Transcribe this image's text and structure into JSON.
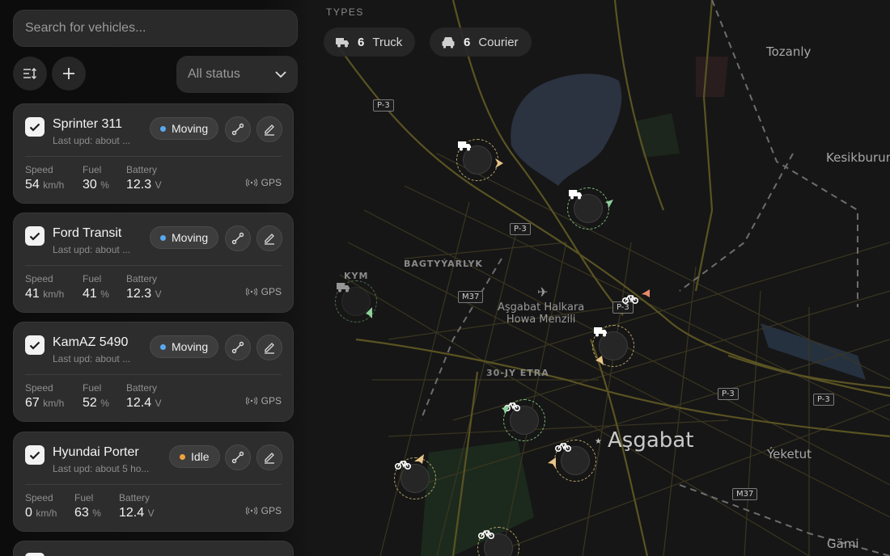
{
  "search": {
    "placeholder": "Search for vehicles..."
  },
  "toolbar": {
    "status_filter": "All status"
  },
  "types": {
    "title": "TYPES",
    "chips": [
      {
        "count": "6",
        "label": "Truck",
        "icon": "truck-icon"
      },
      {
        "count": "6",
        "label": "Courier",
        "icon": "car-icon"
      }
    ]
  },
  "metric_labels": {
    "speed": "Speed",
    "fuel": "Fuel",
    "battery": "Battery"
  },
  "units": {
    "speed": "km/h",
    "fuel": "%",
    "battery": "V"
  },
  "gps_label": "GPS",
  "vehicles": [
    {
      "name": "Sprinter 311",
      "updated": "Last upd: about ...",
      "status": "Moving",
      "status_color": "#5aa9f0",
      "speed": "54",
      "fuel": "30",
      "battery": "12.3"
    },
    {
      "name": "Ford Transit",
      "updated": "Last upd: about ...",
      "status": "Moving",
      "status_color": "#5aa9f0",
      "speed": "41",
      "fuel": "41",
      "battery": "12.3"
    },
    {
      "name": "KamAZ 5490",
      "updated": "Last upd: about ...",
      "status": "Moving",
      "status_color": "#5aa9f0",
      "speed": "67",
      "fuel": "52",
      "battery": "12.4"
    },
    {
      "name": "Hyundai Porter",
      "updated": "Last upd: about 5 ho...",
      "status": "Idle",
      "status_color": "#f0a23c",
      "speed": "0",
      "fuel": "63",
      "battery": "12.4"
    }
  ],
  "map": {
    "labels": {
      "tozanly": "Tozanly",
      "kesikburun": "Kesikburun",
      "bagtyyarlyk": "BAGTYÝARLYK",
      "kym": "KYM",
      "airport": "Aşgabat Halkara\nHowa Menzili",
      "etrap": "30-JY ETRA",
      "city": "Aşgabat",
      "yeketut": "Ýeketut",
      "gami": "Gämi"
    },
    "shields": [
      "P-3",
      "P-3",
      "M37",
      "P-3",
      "P-3",
      "P-3",
      "M37"
    ]
  }
}
